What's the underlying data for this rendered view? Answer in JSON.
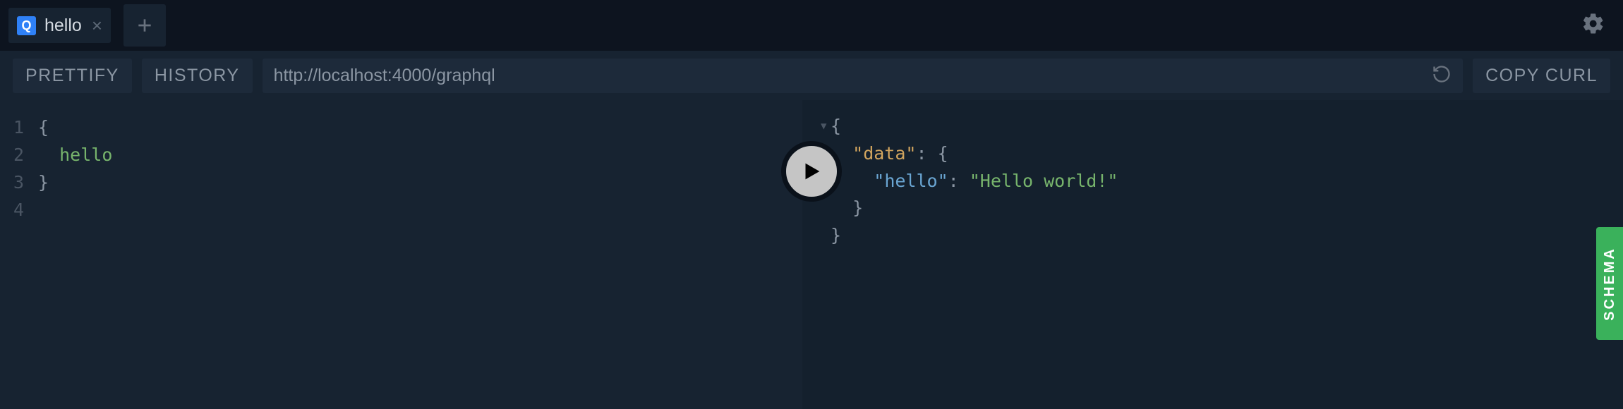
{
  "tabs": {
    "active": {
      "icon": "Q",
      "title": "hello"
    }
  },
  "toolbar": {
    "prettify": "PRETTIFY",
    "history": "HISTORY",
    "copy_curl": "COPY CURL",
    "url": "http://localhost:4000/graphql"
  },
  "editor": {
    "lines": [
      "1",
      "2",
      "3",
      "4"
    ],
    "brace_open": "{",
    "field": "hello",
    "brace_close": "}"
  },
  "response": {
    "l1": "{",
    "l2_key": "\"data\"",
    "l2_rest": ": {",
    "l3_key": "\"hello\"",
    "l3_sep": ": ",
    "l3_val": "\"Hello world!\"",
    "l4": "}",
    "l5": "}"
  },
  "schema_tab": "SCHEMA"
}
